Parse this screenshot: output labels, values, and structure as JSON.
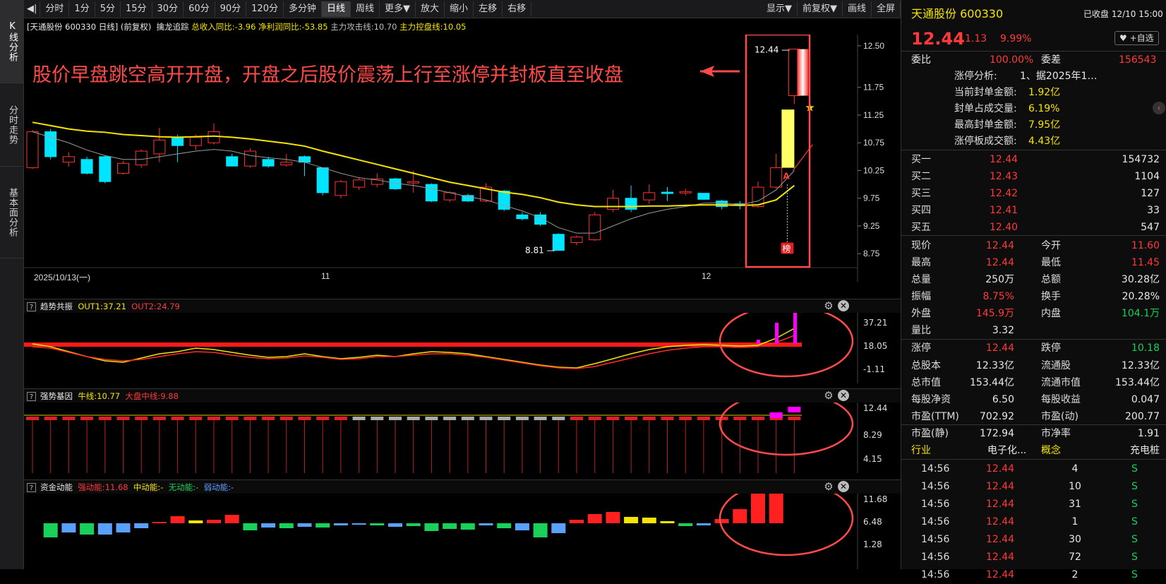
{
  "left_tabs": [
    {
      "label": "K线分析"
    },
    {
      "label": "分时走势"
    },
    {
      "label": "基本面分析"
    }
  ],
  "toolbar": {
    "items": [
      "分时",
      "1分",
      "5分",
      "15分",
      "30分",
      "60分",
      "90分",
      "120分",
      "多分钟",
      "日线",
      "周线",
      "更多▼",
      "放大",
      "缩小",
      "左移",
      "右移"
    ],
    "active": "日线",
    "right_items": [
      "显示▼",
      "前复权▼",
      "画线",
      "全屏"
    ]
  },
  "info": {
    "stock": "[天通股份 600330 日线]",
    "adj": "(前复权)",
    "indicator": "擒龙追踪",
    "rev": "总收入同比:-3.96",
    "profit": "净利润同比:-53.85",
    "attack": "主力攻击线:10.70",
    "control": "主力控盘线:10.05"
  },
  "annotation": "股价早盘跳空高开开盘，开盘之后股价震荡上行至涨停并封板直至收盘",
  "main_chart": {
    "y_ticks": [
      "12.50",
      "11.75",
      "11.25",
      "10.75",
      "10.25",
      "9.75",
      "9.25",
      "8.75"
    ],
    "x_labels": [
      "2025/10/13(一)",
      "11",
      "12"
    ],
    "high_label": "12.44",
    "low_label": "8.81",
    "badge": "榜",
    "a_mark": "A"
  },
  "panel1": {
    "name": "趋势共振",
    "out1": "OUT1:37.21",
    "out2": "OUT2:24.79",
    "y_ticks": [
      "37.21",
      "18.05",
      "-1.11"
    ]
  },
  "panel2": {
    "name": "强势基因",
    "l1": "牛线:10.77",
    "l2": "大盘中线:9.88",
    "y_ticks": [
      "12.44",
      "8.29",
      "4.15"
    ]
  },
  "panel3": {
    "name": "资金动能",
    "l1": "强动能:11.68",
    "l2": "中动能:-",
    "l3": "无动能:-",
    "l4": "弱动能:-",
    "y_ticks": [
      "11.68",
      "6.48",
      "1.28"
    ]
  },
  "colors": {
    "up": "#ff3333",
    "down": "#00e5ff",
    "ma_yellow": "#f5e500",
    "ma_gray": "#9a9a9a",
    "highlight": "#ff4a4a"
  },
  "chart_data": {
    "type": "candlestick",
    "ylim": [
      8.6,
      12.6
    ],
    "candles": [
      [
        10.3,
        10.95,
        10.98,
        10.28
      ],
      [
        10.95,
        10.5,
        11.0,
        10.45
      ],
      [
        10.4,
        10.5,
        10.58,
        10.32
      ],
      [
        10.45,
        10.2,
        10.5,
        10.18
      ],
      [
        10.5,
        10.05,
        10.52,
        10.02
      ],
      [
        10.2,
        10.38,
        10.42,
        10.18
      ],
      [
        10.35,
        10.6,
        10.63,
        10.3
      ],
      [
        10.55,
        10.8,
        11.02,
        10.4
      ],
      [
        10.85,
        10.7,
        10.9,
        10.4
      ],
      [
        10.7,
        10.85,
        10.9,
        10.62
      ],
      [
        10.75,
        10.95,
        11.1,
        10.72
      ],
      [
        10.5,
        10.33,
        10.55,
        10.32
      ],
      [
        10.33,
        10.6,
        10.65,
        10.3
      ],
      [
        10.45,
        10.33,
        10.5,
        10.3
      ],
      [
        10.35,
        10.4,
        10.55,
        10.32
      ],
      [
        10.5,
        10.4,
        10.52,
        10.15
      ],
      [
        10.3,
        9.85,
        10.3,
        9.8
      ],
      [
        9.8,
        10.05,
        10.08,
        9.75
      ],
      [
        9.95,
        10.08,
        10.12,
        9.9
      ],
      [
        10.0,
        10.1,
        10.2,
        9.95
      ],
      [
        10.1,
        9.92,
        10.12,
        9.9
      ],
      [
        10.05,
        10.05,
        10.25,
        9.85
      ],
      [
        10.0,
        9.7,
        10.02,
        9.68
      ],
      [
        9.72,
        9.85,
        9.88,
        9.68
      ],
      [
        9.8,
        9.7,
        9.83,
        9.68
      ],
      [
        9.7,
        9.95,
        10.02,
        9.68
      ],
      [
        9.88,
        9.55,
        9.9,
        9.52
      ],
      [
        9.45,
        9.38,
        9.5,
        9.35
      ],
      [
        9.45,
        9.28,
        9.5,
        9.25
      ],
      [
        9.1,
        8.81,
        9.12,
        8.81
      ],
      [
        8.95,
        9.05,
        9.08,
        8.9
      ],
      [
        9.0,
        9.45,
        9.5,
        8.98
      ],
      [
        9.55,
        9.75,
        9.9,
        9.5
      ],
      [
        9.75,
        9.55,
        9.98,
        9.5
      ],
      [
        9.72,
        9.85,
        10.0,
        9.65
      ],
      [
        9.86,
        9.84,
        9.95,
        9.7
      ],
      [
        9.85,
        9.87,
        9.92,
        9.8
      ],
      [
        9.84,
        9.73,
        9.84,
        9.72
      ],
      [
        9.7,
        9.6,
        9.72,
        9.55
      ],
      [
        9.65,
        9.63,
        9.7,
        9.55
      ],
      [
        9.6,
        9.95,
        10.05,
        9.58
      ],
      [
        9.95,
        10.3,
        10.55,
        9.92
      ],
      [
        11.6,
        12.44,
        12.44,
        11.45
      ]
    ],
    "ma_yellow": [
      11.12,
      11.06,
      11.0,
      10.96,
      10.94,
      10.9,
      10.88,
      10.86,
      10.85,
      10.86,
      10.87,
      10.85,
      10.82,
      10.78,
      10.74,
      10.69,
      10.6,
      10.52,
      10.44,
      10.36,
      10.28,
      10.2,
      10.12,
      10.04,
      9.98,
      9.92,
      9.86,
      9.82,
      9.76,
      9.68,
      9.63,
      9.6,
      9.6,
      9.6,
      9.61,
      9.61,
      9.62,
      9.63,
      9.63,
      9.62,
      9.63,
      9.72,
      9.98
    ],
    "ma_gray": [
      10.95,
      10.85,
      10.75,
      10.62,
      10.52,
      10.45,
      10.45,
      10.5,
      10.55,
      10.6,
      10.63,
      10.6,
      10.52,
      10.48,
      10.45,
      10.4,
      10.3,
      10.2,
      10.12,
      10.08,
      10.02,
      9.98,
      9.92,
      9.85,
      9.78,
      9.72,
      9.62,
      9.52,
      9.4,
      9.22,
      9.12,
      9.12,
      9.25,
      9.38,
      9.48,
      9.55,
      9.6,
      9.66,
      9.67,
      9.63,
      9.7,
      9.9,
      10.25
    ]
  }
}
